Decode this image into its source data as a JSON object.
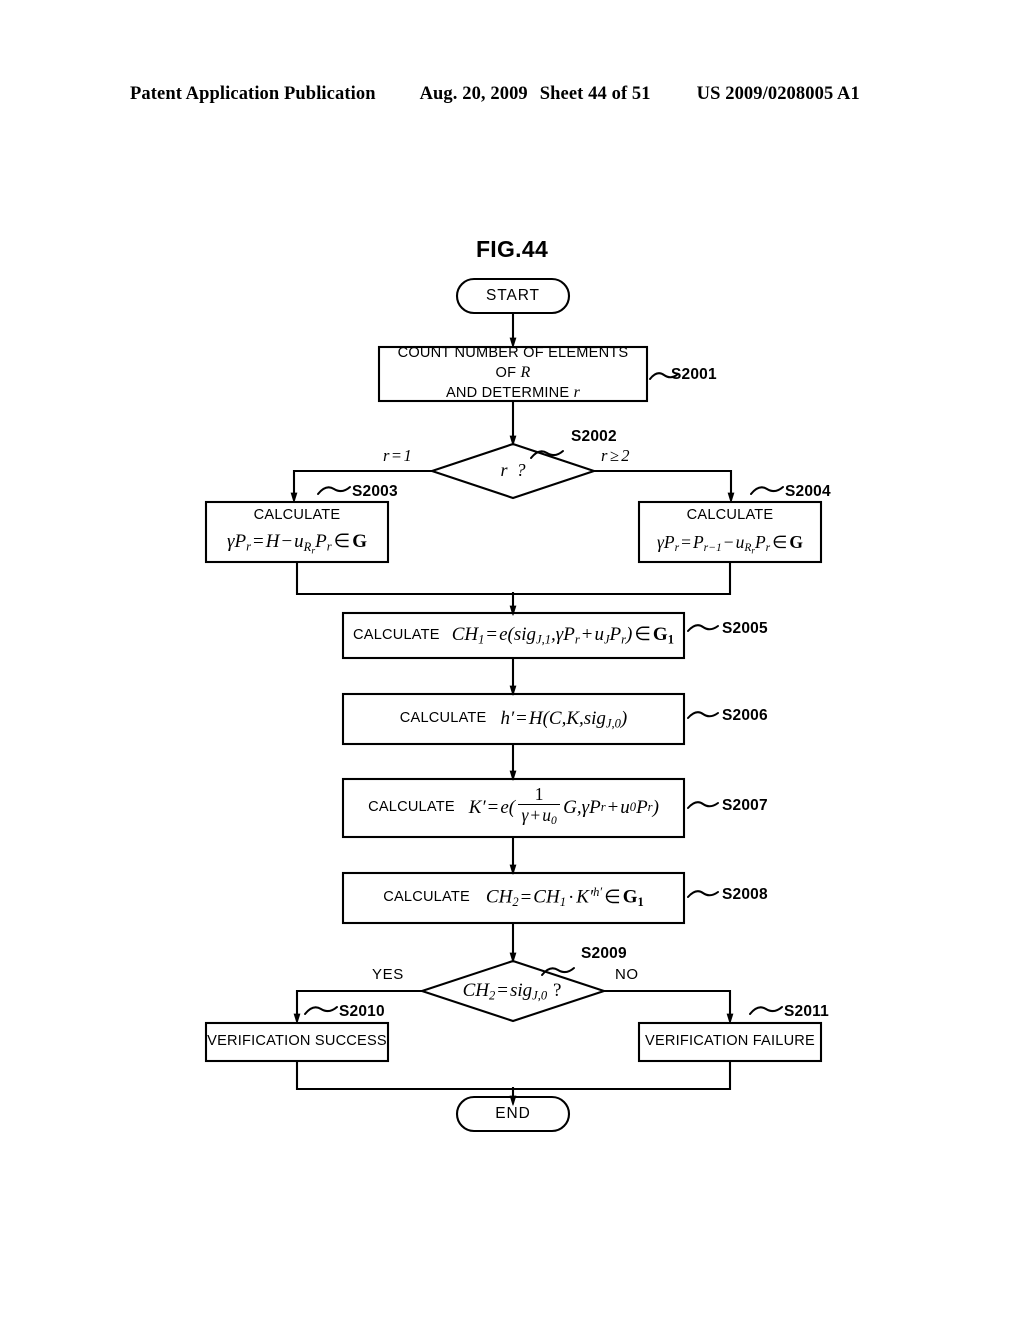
{
  "header": {
    "publication": "Patent Application Publication",
    "date": "Aug. 20, 2009",
    "sheet": "Sheet 44 of 51",
    "patent_number": "US 2009/0208005 A1"
  },
  "figure": {
    "title": "FIG.44"
  },
  "nodes": {
    "start": {
      "label": "START",
      "shape": "terminal"
    },
    "end": {
      "label": "END",
      "shape": "terminal"
    },
    "s2001": {
      "tag": "S2001",
      "shape": "process",
      "line1": "COUNT NUMBER OF ELEMENTS OF R",
      "line2": "AND DETERMINE r"
    },
    "s2002": {
      "tag": "S2002",
      "shape": "decision",
      "condition": "r ?",
      "branch_left": "r=1",
      "branch_right": "r ≥ 2"
    },
    "s2003": {
      "tag": "S2003",
      "shape": "process",
      "verb": "CALCULATE",
      "formula_text": "γPr = H − uRr Pr ∈ G"
    },
    "s2004": {
      "tag": "S2004",
      "shape": "process",
      "verb": "CALCULATE",
      "formula_text": "γPr = Pr−1 − uRr Pr ∈ G"
    },
    "s2005": {
      "tag": "S2005",
      "shape": "process",
      "verb": "CALCULATE",
      "formula_text": "CH1 = e(sigJ,1, γPr + uJ Pr) ∈ G1"
    },
    "s2006": {
      "tag": "S2006",
      "shape": "process",
      "verb": "CALCULATE",
      "formula_text": "h′ = H(C, K, sigJ,0)"
    },
    "s2007": {
      "tag": "S2007",
      "shape": "process",
      "verb": "CALCULATE",
      "formula_text": "K′ = e(1/(γ + u0) G, γPr + u0Pr)"
    },
    "s2008": {
      "tag": "S2008",
      "shape": "process",
      "verb": "CALCULATE",
      "formula_text": "CH2 = CH1 · K′ h′ ∈ G1"
    },
    "s2009": {
      "tag": "S2009",
      "shape": "decision",
      "condition": "CH2 = sigJ,0 ?",
      "branch_left": "YES",
      "branch_right": "NO"
    },
    "s2010": {
      "tag": "S2010",
      "shape": "process",
      "label": "VERIFICATION SUCCESS"
    },
    "s2011": {
      "tag": "S2011",
      "shape": "process",
      "label": "VERIFICATION FAILURE"
    }
  },
  "colors": {
    "stroke": "#000000",
    "background": "#ffffff"
  }
}
